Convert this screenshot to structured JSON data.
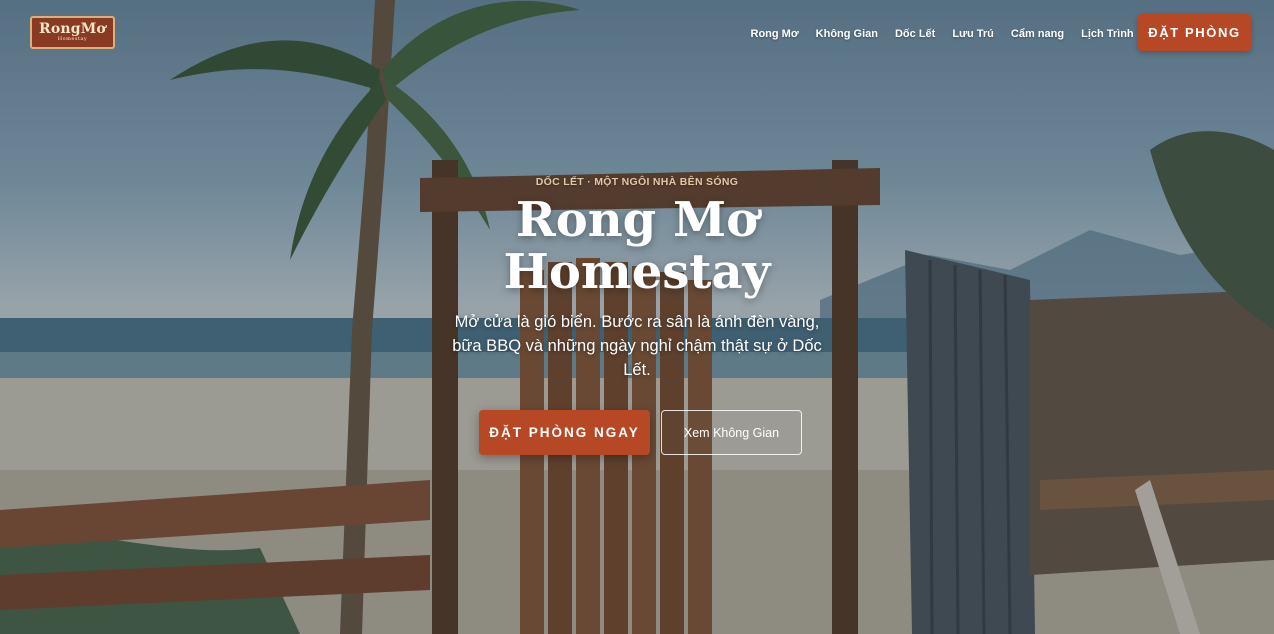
{
  "brand": {
    "logo_main": "RongMơ",
    "logo_sub": "Homestay"
  },
  "nav": {
    "items": [
      {
        "label": "Rong Mơ"
      },
      {
        "label": "Không Gian"
      },
      {
        "label": "Dốc Lết"
      },
      {
        "label": "Lưu Trú"
      },
      {
        "label": "Cẩm nang"
      },
      {
        "label": "Lịch Trình"
      }
    ],
    "cta_label": "ĐẶT PHÒNG"
  },
  "hero": {
    "eyebrow": "DỐC LẾT · MỘT NGÔI NHÀ BÊN SÓNG",
    "title": "Rong Mơ Homestay",
    "subtitle": "Mở cửa là gió biển. Bước ra sân là ánh đèn vàng, bữa BBQ và những ngày nghỉ chậm thật sự ở Dốc Lết.",
    "primary_button": "ĐẶT PHÒNG NGAY",
    "secondary_button": "Xem Không Gian"
  },
  "colors": {
    "accent": "#b64826",
    "eyebrow": "#e2c6a8",
    "logo_bg": "#8a3a22"
  }
}
